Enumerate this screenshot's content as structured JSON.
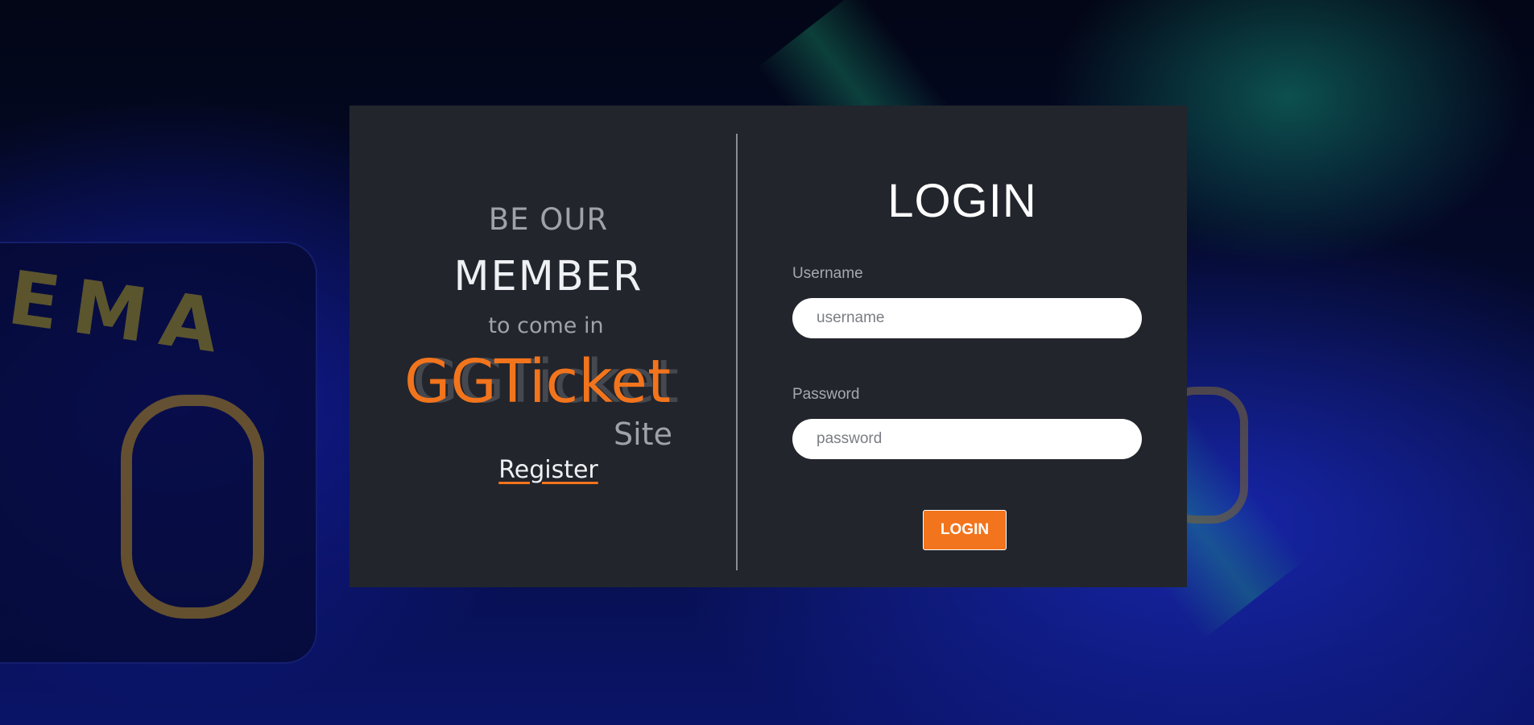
{
  "left_panel": {
    "line1": "BE OUR",
    "line2": "MEMBER",
    "line3": "to come in",
    "brand": "GGTicket",
    "brand_suffix": "Site",
    "register_label": "Register"
  },
  "login_form": {
    "title": "LOGIN",
    "username_label": "Username",
    "username_placeholder": "username",
    "username_value": "",
    "password_label": "Password",
    "password_placeholder": "password",
    "password_value": "",
    "submit_label": "LOGIN"
  },
  "colors": {
    "accent": "#f2741c",
    "card_background": "#22252c",
    "muted_text": "#9fa2a8"
  }
}
